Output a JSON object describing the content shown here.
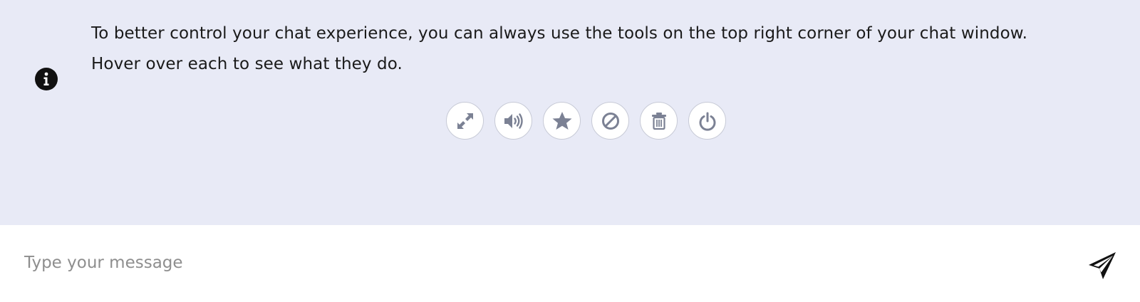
{
  "info": {
    "icon": "info-circle-icon",
    "line1": "To better control your chat experience, you can always use the tools on the top right corner of your chat window.",
    "line2": "Hover over each to see what they do."
  },
  "tools": [
    {
      "name": "expand",
      "icon": "expand-arrows-icon"
    },
    {
      "name": "sound",
      "icon": "volume-icon"
    },
    {
      "name": "rate",
      "icon": "star-icon"
    },
    {
      "name": "block",
      "icon": "ban-icon"
    },
    {
      "name": "delete",
      "icon": "trash-icon"
    },
    {
      "name": "end",
      "icon": "power-icon"
    }
  ],
  "composer": {
    "placeholder": "Type your message",
    "value": "",
    "send_icon": "paper-plane-icon"
  },
  "colors": {
    "chat_background": "#e8eaf6",
    "icon_gray": "#7b8194",
    "text": "#1a1a1a",
    "placeholder": "#8e8e8e"
  }
}
